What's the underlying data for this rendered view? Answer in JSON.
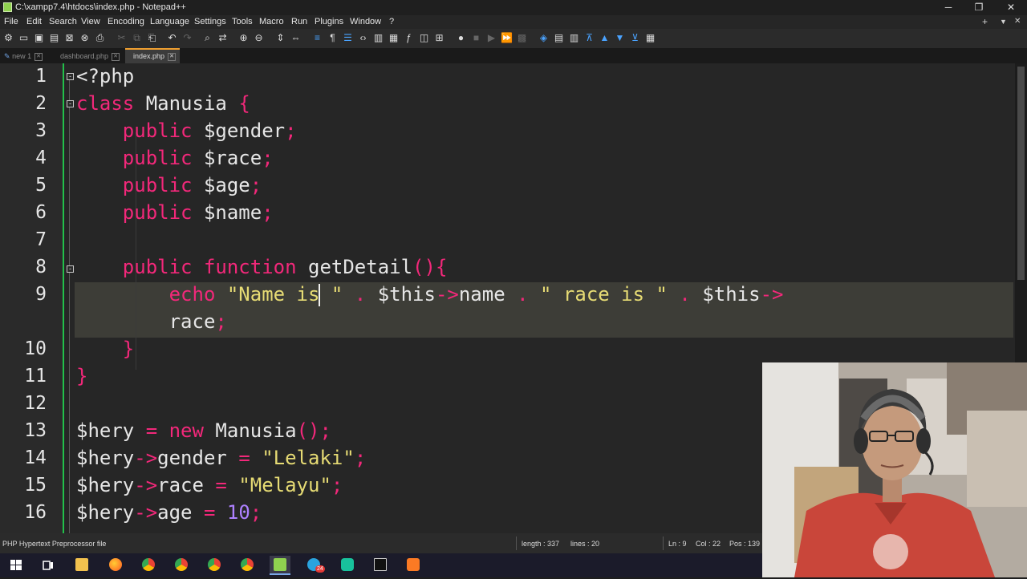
{
  "window": {
    "title": "C:\\xampp7.4\\htdocs\\index.php - Notepad++"
  },
  "window_controls": {
    "minimize": "─",
    "restore": "❐",
    "close": "✕"
  },
  "menu": {
    "items": [
      "File",
      "Edit",
      "Search",
      "View",
      "Encoding",
      "Language",
      "Settings",
      "Tools",
      "Macro",
      "Run",
      "Plugins",
      "Window",
      "?"
    ],
    "right": [
      "+",
      "▼",
      "✕"
    ]
  },
  "toolbar": {
    "icons": [
      "new-file-icon",
      "open-file-icon",
      "save-icon",
      "save-all-icon",
      "close-icon",
      "close-all-icon",
      "print-icon",
      "cut-icon",
      "copy-icon",
      "paste-icon",
      "undo-icon",
      "redo-icon",
      "find-icon",
      "replace-icon",
      "zoom-in-icon",
      "zoom-out-icon",
      "sync-vertical-icon",
      "sync-horizontal-icon",
      "word-wrap-icon",
      "show-all-characters-icon",
      "indent-guide-icon",
      "xml-tags-icon",
      "document-map-icon",
      "folder-as-workspace-icon",
      "function-list-icon",
      "monitoring-icon",
      "clipboard-history-icon",
      "record-macro-icon",
      "stop-recording-icon",
      "playback-macro-icon",
      "run-macro-multiple-icon",
      "save-macro-icon"
    ]
  },
  "tabs": [
    {
      "label": "new 1",
      "active": false
    },
    {
      "label": "dashboard.php",
      "active": false
    },
    {
      "label": "index.php",
      "active": true
    }
  ],
  "editor": {
    "line_numbers": [
      "1",
      "2",
      "3",
      "4",
      "5",
      "6",
      "7",
      "8",
      "9",
      "10",
      "11",
      "12",
      "13",
      "14",
      "15",
      "16"
    ],
    "colors": {
      "keyword": "#f2287a",
      "string": "#e6db74",
      "number": "#ae81ff",
      "text": "#e6e6e6",
      "fold_margin": "#22c04a"
    },
    "lines": {
      "l1": "<?php",
      "l2_kw": "class",
      "l2_name": "Manusia",
      "l2_brace": "{",
      "l3_kw": "public",
      "l3_var": "$gender",
      "l4_kw": "public",
      "l4_var": "$race",
      "l5_kw": "public",
      "l5_var": "$age",
      "l6_kw": "public",
      "l6_var": "$name",
      "semi": ";",
      "l8_kw1": "public",
      "l8_kw2": "function",
      "l8_name": "getDetail",
      "l8_tail": "(){",
      "l9_echo": "echo",
      "l9_str1a": "\"Name is",
      "l9_str1b": " \"",
      "l9_dot": ".",
      "l9_this1": "$this",
      "l9_arrow": "->",
      "l9_name": "name",
      "l9_str2": "\" race is \"",
      "l9_this2": "$this",
      "l9b_race": "race",
      "l10_brace": "}",
      "l11_brace": "}",
      "l13_var": "$hery",
      "l13_eq": "=",
      "l13_new": "new",
      "l13_class": "Manusia",
      "l13_tail": "();",
      "l14_var": "$hery",
      "l14_prop": "gender",
      "l14_eq": "=",
      "l14_str": "\"Lelaki\"",
      "l15_var": "$hery",
      "l15_prop": "race",
      "l15_eq": "=",
      "l15_str": "\"Melayu\"",
      "l16_var": "$hery",
      "l16_prop": "age",
      "l16_eq": "=",
      "l16_num": "10"
    }
  },
  "statusbar": {
    "filetype": "PHP Hypertext Preprocessor file",
    "length": "length : 337",
    "lines": "lines : 20",
    "ln": "Ln : 9",
    "col": "Col : 22",
    "pos": "Pos : 139"
  },
  "taskbar": {
    "icons": [
      "windows-start-icon",
      "task-view-icon",
      "file-explorer-icon",
      "firefox-icon",
      "chrome-icon",
      "chrome-icon",
      "chrome-icon",
      "chrome-icon",
      "notepad-plus-plus-icon",
      "telegram-icon",
      "game-controller-icon",
      "terminal-icon",
      "xampp-icon"
    ],
    "badge": "24"
  }
}
